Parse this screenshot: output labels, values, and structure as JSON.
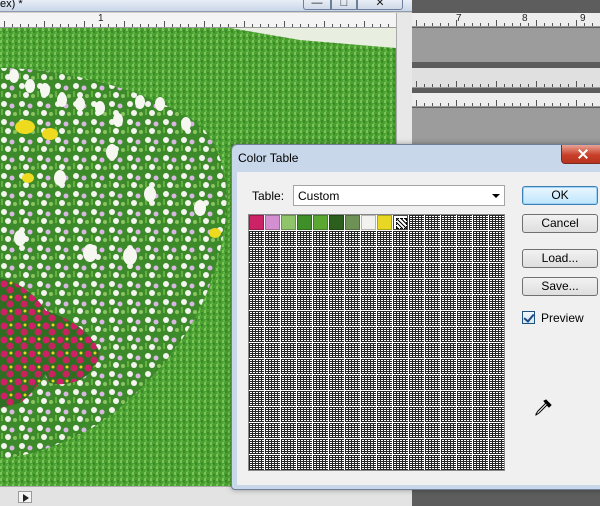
{
  "doc_window": {
    "title": "ex) *",
    "minimize_symbol": "—",
    "maximize_symbol": "□",
    "close_symbol": "✕",
    "ruler": [
      {
        "label": "1"
      }
    ]
  },
  "right_panel": {
    "ruler_top": [
      {
        "label": "7"
      },
      {
        "label": "8"
      },
      {
        "label": "9"
      }
    ]
  },
  "dialog": {
    "title": "Color Table",
    "table_label": "Table:",
    "table_value": "Custom",
    "buttons": {
      "ok": "OK",
      "cancel": "Cancel",
      "load": "Load...",
      "save": "Save..."
    },
    "preview_label": "Preview",
    "preview_checked": true,
    "colors": [
      "#cc2266",
      "#d48fd0",
      "#8fc46a",
      "#3f8f28",
      "#5aa832",
      "#2c5e1e",
      "#6e9156",
      "#f2f2ee",
      "#e8d824",
      "transparent"
    ],
    "grid": {
      "columns": 16,
      "rows": 16
    }
  },
  "icons": {
    "close": "close-icon",
    "dropdown": "chevron-down-icon",
    "eyedropper": "eyedropper-icon",
    "checkbox": "checkmark-icon"
  }
}
